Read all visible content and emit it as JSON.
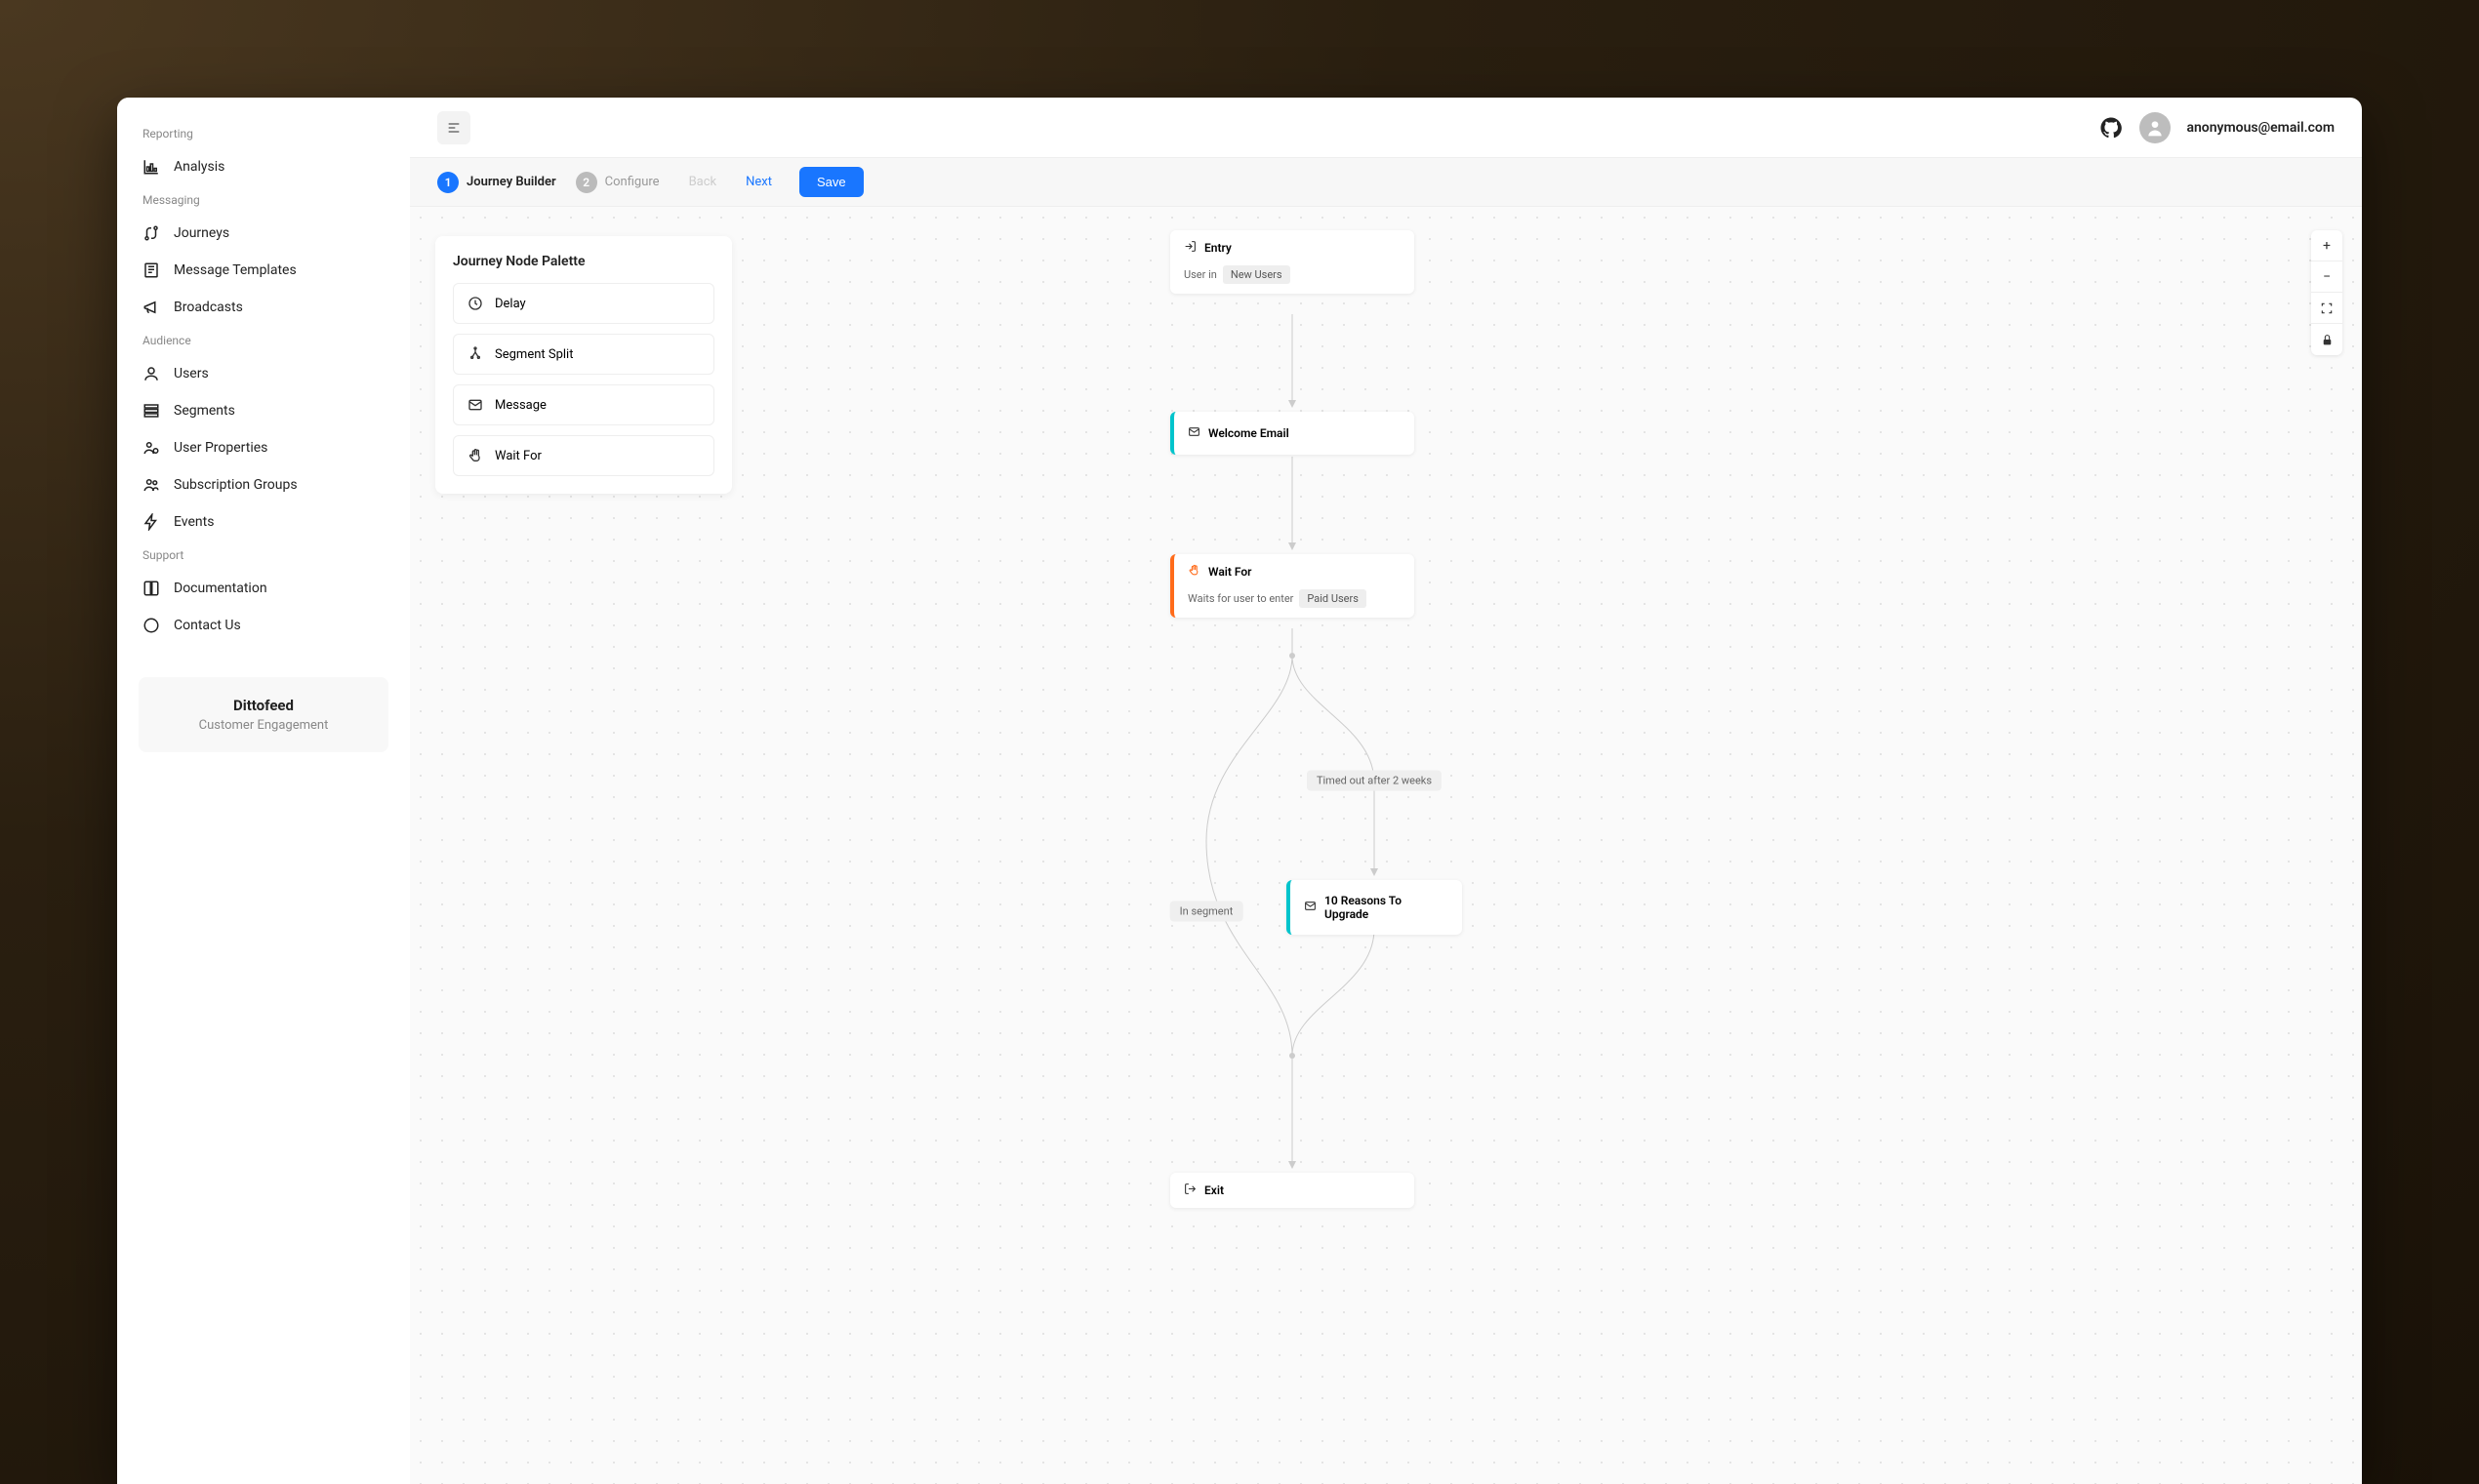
{
  "topbar": {
    "user_email": "anonymous@email.com"
  },
  "sidebar": {
    "sections": {
      "reporting": {
        "label": "Reporting",
        "items": [
          {
            "label": "Analysis",
            "icon": "chart-icon"
          }
        ]
      },
      "messaging": {
        "label": "Messaging",
        "items": [
          {
            "label": "Journeys",
            "icon": "route-icon"
          },
          {
            "label": "Message Templates",
            "icon": "template-icon"
          },
          {
            "label": "Broadcasts",
            "icon": "megaphone-icon"
          }
        ]
      },
      "audience": {
        "label": "Audience",
        "items": [
          {
            "label": "Users",
            "icon": "user-icon"
          },
          {
            "label": "Segments",
            "icon": "segments-icon"
          },
          {
            "label": "User Properties",
            "icon": "user-props-icon"
          },
          {
            "label": "Subscription Groups",
            "icon": "group-icon"
          },
          {
            "label": "Events",
            "icon": "bolt-icon"
          }
        ]
      },
      "support": {
        "label": "Support",
        "items": [
          {
            "label": "Documentation",
            "icon": "book-icon"
          },
          {
            "label": "Contact Us",
            "icon": "chat-icon"
          }
        ]
      }
    },
    "brand": {
      "name": "Dittofeed",
      "tagline": "Customer Engagement"
    }
  },
  "steps": {
    "s1": {
      "num": "1",
      "label": "Journey Builder"
    },
    "s2": {
      "num": "2",
      "label": "Configure"
    },
    "back": "Back",
    "next": "Next",
    "save": "Save"
  },
  "palette": {
    "title": "Journey Node Palette",
    "items": {
      "delay": "Delay",
      "segment_split": "Segment Split",
      "message": "Message",
      "wait_for": "Wait For"
    }
  },
  "flow": {
    "entry": {
      "title": "Entry",
      "body_prefix": "User in",
      "tag": "New Users"
    },
    "welcome": {
      "title": "Welcome Email"
    },
    "waitfor": {
      "title": "Wait For",
      "body_prefix": "Waits for user to enter",
      "tag": "Paid Users"
    },
    "edge_timeout": "Timed out after 2 weeks",
    "edge_in_segment": "In segment",
    "upgrade": {
      "title": "10 Reasons To Upgrade"
    },
    "exit": {
      "title": "Exit"
    }
  },
  "zoom": {
    "in": "+",
    "out": "−"
  }
}
